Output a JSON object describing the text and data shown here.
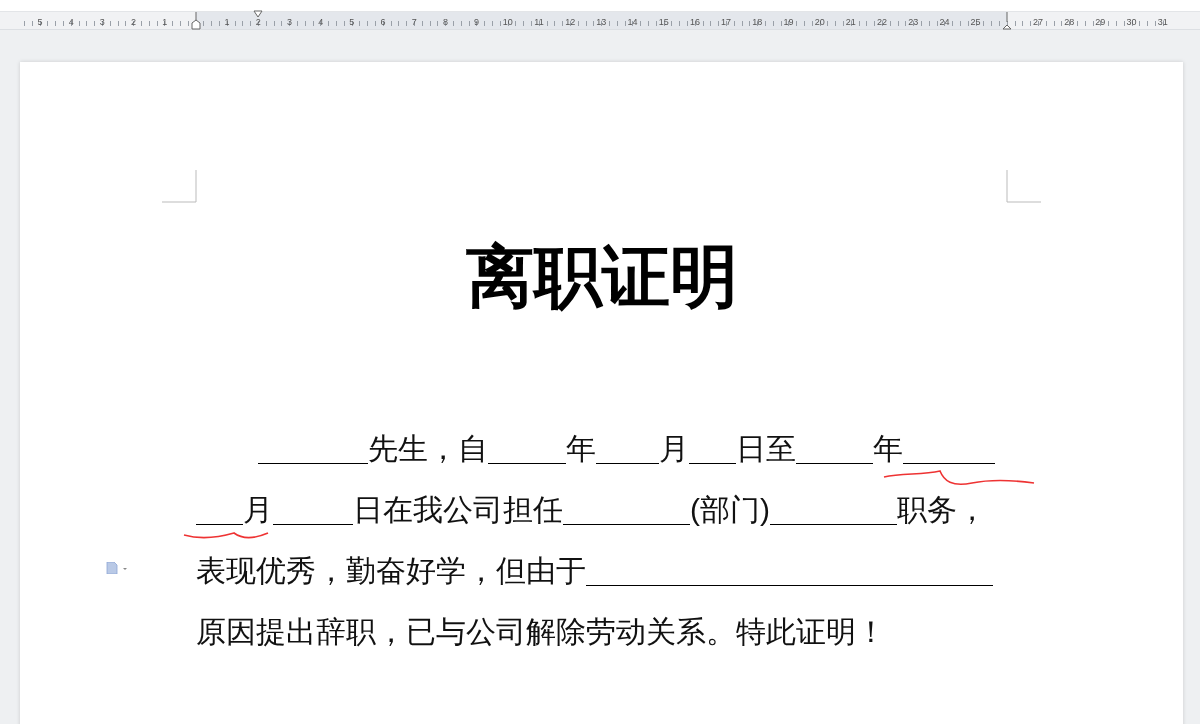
{
  "ruler": {
    "left_numbers": [
      "5",
      "4",
      "3",
      "2",
      "1"
    ],
    "numbers": [
      "1",
      "2",
      "3",
      "4",
      "5",
      "6",
      "7",
      "8",
      "9",
      "10",
      "11",
      "12",
      "13",
      "14",
      "15",
      "16",
      "17",
      "18",
      "19",
      "20",
      "21",
      "22",
      "23",
      "24",
      "25"
    ],
    "right_numbers": [
      "27",
      "28",
      "29",
      "30",
      "31"
    ]
  },
  "document": {
    "title": "离职证明",
    "lines": [
      {
        "segments": [
          {
            "kind": "blank"
          },
          {
            "kind": "text",
            "text": "先生，自"
          },
          {
            "kind": "blank"
          },
          {
            "kind": "text",
            "text": "年"
          },
          {
            "kind": "blank"
          },
          {
            "kind": "text",
            "text": "月"
          },
          {
            "kind": "blank"
          },
          {
            "kind": "text",
            "text": "日至"
          },
          {
            "kind": "blank"
          },
          {
            "kind": "text",
            "text": "年"
          },
          {
            "kind": "blank"
          }
        ]
      },
      {
        "segments": [
          {
            "kind": "blank"
          },
          {
            "kind": "text",
            "text": "月"
          },
          {
            "kind": "blank"
          },
          {
            "kind": "text",
            "text": "日在我公司担任"
          },
          {
            "kind": "blank"
          },
          {
            "kind": "text",
            "text": "(部门)"
          },
          {
            "kind": "blank"
          },
          {
            "kind": "text",
            "text": "职务，"
          }
        ]
      },
      {
        "segments": [
          {
            "kind": "text",
            "text": "表现优秀，勤奋好学，但由于"
          },
          {
            "kind": "blank"
          }
        ]
      },
      {
        "segments": [
          {
            "kind": "text",
            "text": "原因提出辞职，已与公司解除劳动关系。特此证明！"
          }
        ]
      }
    ]
  }
}
